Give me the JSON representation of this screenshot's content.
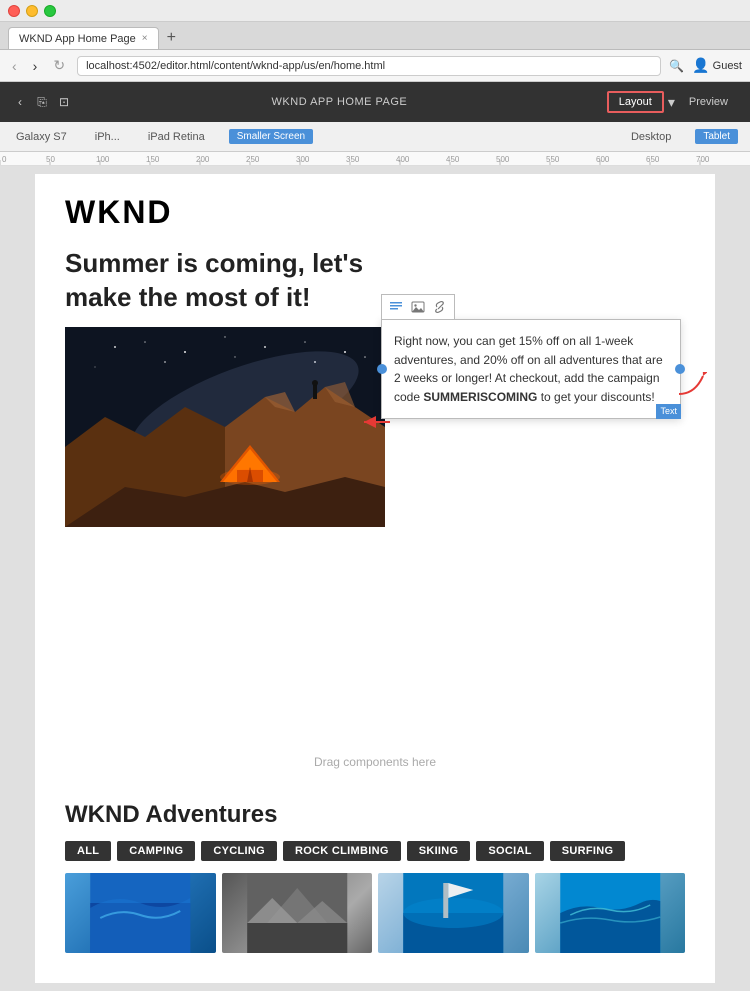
{
  "browser": {
    "tab_title": "WKND App Home Page",
    "tab_close": "×",
    "address": "localhost:4502/editor.html/content/wknd-app/us/en/home.html",
    "nav_back": "‹",
    "nav_forward": "›",
    "guest_label": "Guest"
  },
  "aem": {
    "page_title": "WKND APP HOME PAGE",
    "layout_label": "Layout",
    "preview_label": "Preview"
  },
  "viewport": {
    "galaxy": "Galaxy S7",
    "iphone": "iPh...",
    "ipad": "iPad Retina",
    "smaller_screen": "Smaller Screen",
    "desktop": "Desktop",
    "tablet": "Tablet"
  },
  "page": {
    "logo": "WKND",
    "hero_title": "Summer is coming, let’s make the most of it!",
    "callout_text": "Right now, you can get 15% off on all 1-week adventures, and 20% off on all adventures that are 2 weeks or longer! At checkout, add the campaign code ",
    "callout_code": "SUMMERISCOMING",
    "callout_suffix": " to get your discounts!",
    "text_badge": "Text",
    "drag_label": "Drag components here",
    "adventures_title": "WKND Adventures",
    "tags": [
      "ALL",
      "CAMPING",
      "CYCLING",
      "ROCK CLIMBING",
      "SKIING",
      "SOCIAL",
      "SURFING"
    ]
  }
}
